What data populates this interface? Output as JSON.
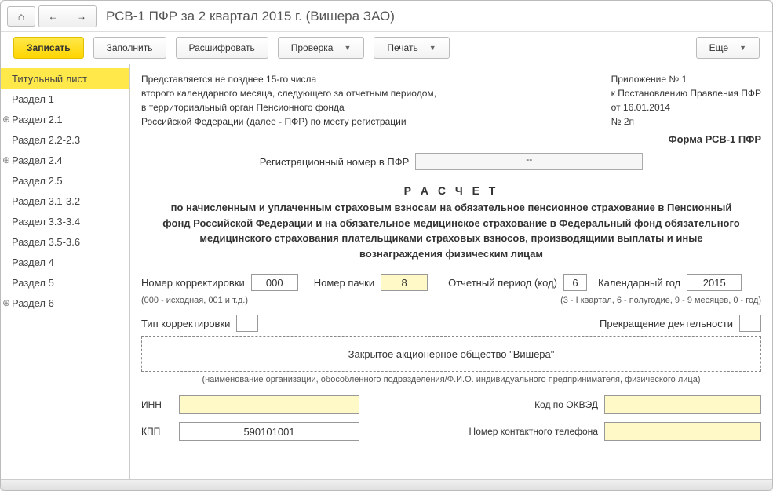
{
  "header": {
    "title": "РСВ-1 ПФР за 2 квартал 2015 г. (Вишера ЗАО)"
  },
  "toolbar": {
    "save": "Записать",
    "fill": "Заполнить",
    "decode": "Расшифровать",
    "check": "Проверка",
    "print": "Печать",
    "more": "Еще"
  },
  "sidebar": {
    "items": [
      {
        "label": "Титульный лист",
        "active": true,
        "expandable": false
      },
      {
        "label": "Раздел 1",
        "active": false,
        "expandable": false
      },
      {
        "label": "Раздел 2.1",
        "active": false,
        "expandable": true
      },
      {
        "label": "Раздел 2.2-2.3",
        "active": false,
        "expandable": false
      },
      {
        "label": "Раздел 2.4",
        "active": false,
        "expandable": true
      },
      {
        "label": "Раздел 2.5",
        "active": false,
        "expandable": false
      },
      {
        "label": "Раздел 3.1-3.2",
        "active": false,
        "expandable": false
      },
      {
        "label": "Раздел 3.3-3.4",
        "active": false,
        "expandable": false
      },
      {
        "label": "Раздел 3.5-3.6",
        "active": false,
        "expandable": false
      },
      {
        "label": "Раздел 4",
        "active": false,
        "expandable": false
      },
      {
        "label": "Раздел 5",
        "active": false,
        "expandable": false
      },
      {
        "label": "Раздел 6",
        "active": false,
        "expandable": true
      }
    ]
  },
  "doc": {
    "submit_info_1": "Представляется не позднее 15-го числа",
    "submit_info_2": "второго календарного месяца, следующего за отчетным периодом,",
    "submit_info_3": "в территориальный орган Пенсионного фонда",
    "submit_info_4": "Российской Федерации (далее - ПФР) по месту регистрации",
    "appendix_1": "Приложение № 1",
    "appendix_2": "к Постановлению Правления ПФР",
    "appendix_3": "от 16.01.2014",
    "appendix_4": "№ 2п",
    "form_name": "Форма РСВ-1 ПФР",
    "reg_label": "Регистрационный номер в ПФР",
    "reg_value": "--",
    "calc_title": "Р А С Ч Е Т",
    "calc_desc": "по начисленным и уплаченным страховым взносам на обязательное пенсионное страхование в Пенсионный фонд Российской Федерации и на обязательное медицинское страхование в Федеральный фонд обязательного медицинского страхования плательщиками страховых взносов, производящими выплаты и иные вознаграждения физическим лицам",
    "corr_label": "Номер корректировки",
    "corr_value": "000",
    "corr_hint": "(000 - исходная, 001 и т.д.)",
    "pack_label": "Номер пачки",
    "pack_value": "8",
    "period_label": "Отчетный период (код)",
    "period_value": "6",
    "period_hint": "(3 - I квартал, 6 - полугодие, 9 - 9 месяцев, 0 - год)",
    "year_label": "Календарный год",
    "year_value": "2015",
    "corr_type_label": "Тип корректировки",
    "corr_type_value": "",
    "cessation_label": "Прекращение деятельности",
    "cessation_value": "",
    "org_name": "Закрытое акционерное общество \"Вишера\"",
    "org_caption": "(наименование организации, обособленного подразделения/Ф.И.О. индивидуального предпринимателя, физического лица)",
    "inn_label": "ИНН",
    "inn_value": "",
    "okved_label": "Код по ОКВЭД",
    "okved_value": "",
    "kpp_label": "КПП",
    "kpp_value": "590101001",
    "phone_label": "Номер контактного телефона",
    "phone_value": ""
  }
}
